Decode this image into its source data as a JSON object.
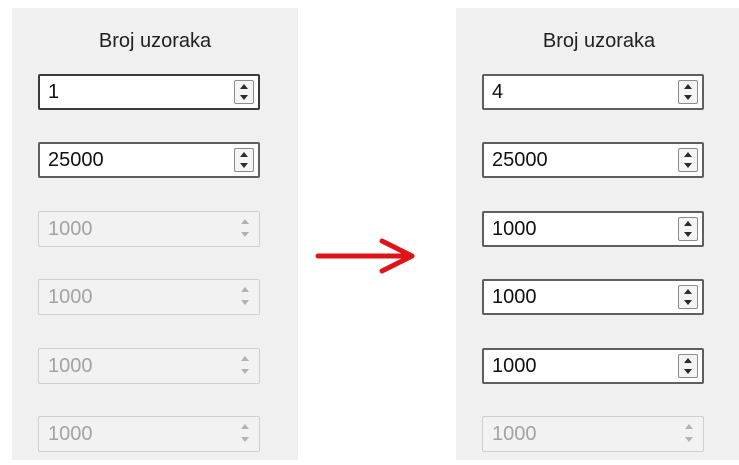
{
  "left_panel": {
    "title": "Broj uzoraka",
    "fields": [
      {
        "value": "1",
        "enabled": true
      },
      {
        "value": "25000",
        "enabled": true
      },
      {
        "value": "1000",
        "enabled": false
      },
      {
        "value": "1000",
        "enabled": false
      },
      {
        "value": "1000",
        "enabled": false
      },
      {
        "value": "1000",
        "enabled": false
      }
    ]
  },
  "right_panel": {
    "title": "Broj uzoraka",
    "fields": [
      {
        "value": "4",
        "enabled": true
      },
      {
        "value": "25000",
        "enabled": true
      },
      {
        "value": "1000",
        "enabled": true
      },
      {
        "value": "1000",
        "enabled": true
      },
      {
        "value": "1000",
        "enabled": true
      },
      {
        "value": "1000",
        "enabled": false
      }
    ]
  },
  "colors": {
    "arrow": "#e0131b",
    "panel_background": "#f0f0f0"
  },
  "icons": {
    "transition": "right-arrow-icon",
    "spin_up": "spin-up-icon",
    "spin_down": "spin-down-icon"
  }
}
